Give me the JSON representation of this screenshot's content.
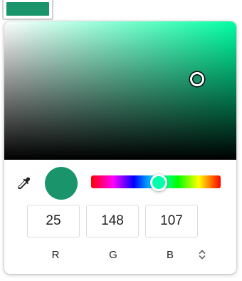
{
  "swatch": {
    "color": "#19946b"
  },
  "picker": {
    "hue_color": "#00ffa4",
    "current_color": "#19946b",
    "saturation": 0.83,
    "value": 0.58,
    "hue_position": 0.53,
    "hue_thumb_color": "#00ffaa",
    "channels": [
      {
        "label": "R",
        "value": "25"
      },
      {
        "label": "G",
        "value": "148"
      },
      {
        "label": "B",
        "value": "107"
      }
    ],
    "icons": {
      "eyedropper": "eyedropper-icon",
      "format_toggle": "up-down-chevron-icon"
    }
  }
}
